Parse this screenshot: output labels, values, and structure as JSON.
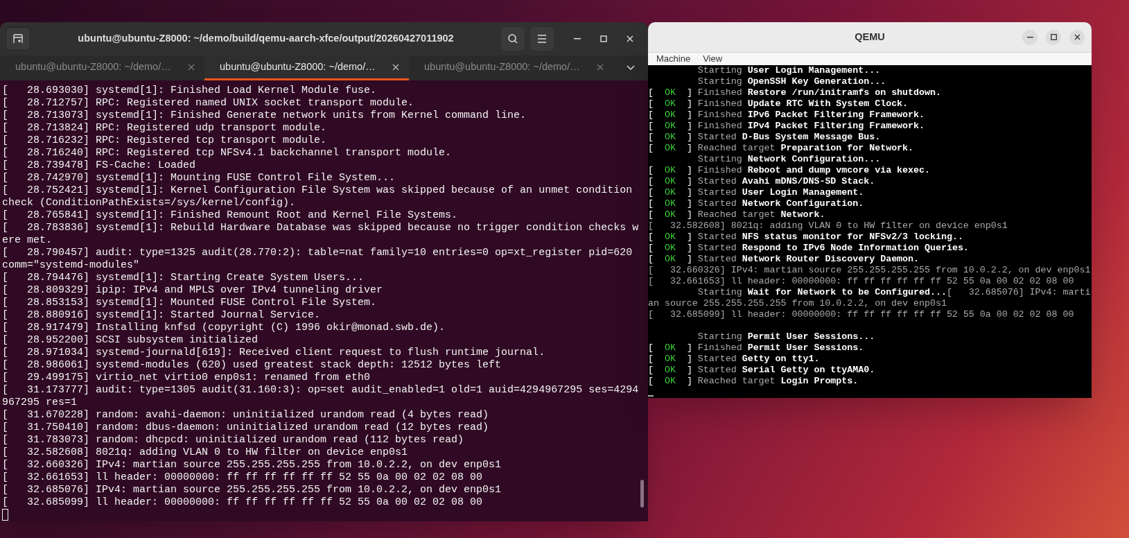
{
  "terminal": {
    "title": "ubuntu@ubuntu-Z8000: ~/demo/build/qemu-aarch-xfce/output/20260427011902",
    "tabs": [
      {
        "label": "ubuntu@ubuntu-Z8000: ~/demo/…",
        "selected": false
      },
      {
        "label": "ubuntu@ubuntu-Z8000: ~/demo/…",
        "selected": true
      },
      {
        "label": "ubuntu@ubuntu-Z8000: ~/demo/…",
        "selected": false
      }
    ],
    "lines": [
      "[   28.693030] systemd[1]: Finished Load Kernel Module fuse.",
      "[   28.712757] RPC: Registered named UNIX socket transport module.",
      "[   28.713073] systemd[1]: Finished Generate network units from Kernel command line.",
      "[   28.713824] RPC: Registered udp transport module.",
      "[   28.716232] RPC: Registered tcp transport module.",
      "[   28.716240] RPC: Registered tcp NFSv4.1 backchannel transport module.",
      "[   28.739478] FS-Cache: Loaded",
      "[   28.742970] systemd[1]: Mounting FUSE Control File System...",
      "[   28.752421] systemd[1]: Kernel Configuration File System was skipped because of an unmet condition",
      "check (ConditionPathExists=/sys/kernel/config).",
      "[   28.765841] systemd[1]: Finished Remount Root and Kernel File Systems.",
      "[   28.783836] systemd[1]: Rebuild Hardware Database was skipped because no trigger condition checks w",
      "ere met.",
      "[   28.790457] audit: type=1325 audit(28.770:2): table=nat family=10 entries=0 op=xt_register pid=620",
      "comm=\"systemd-modules\"",
      "[   28.794476] systemd[1]: Starting Create System Users...",
      "[   28.809329] ipip: IPv4 and MPLS over IPv4 tunneling driver",
      "[   28.853153] systemd[1]: Mounted FUSE Control File System.",
      "[   28.880916] systemd[1]: Started Journal Service.",
      "[   28.917479] Installing knfsd (copyright (C) 1996 okir@monad.swb.de).",
      "[   28.952200] SCSI subsystem initialized",
      "[   28.971034] systemd-journald[619]: Received client request to flush runtime journal.",
      "[   28.986061] systemd-modules (620) used greatest stack depth: 12512 bytes left",
      "[   29.499175] virtio_net virtio0 enp0s1: renamed from eth0",
      "[   31.173777] audit: type=1305 audit(31.160:3): op=set audit_enabled=1 old=1 auid=4294967295 ses=4294",
      "967295 res=1",
      "[   31.670228] random: avahi-daemon: uninitialized urandom read (4 bytes read)",
      "[   31.750410] random: dbus-daemon: uninitialized urandom read (12 bytes read)",
      "[   31.783073] random: dhcpcd: uninitialized urandom read (112 bytes read)",
      "[   32.582608] 8021q: adding VLAN 0 to HW filter on device enp0s1",
      "[   32.660326] IPv4: martian source 255.255.255.255 from 10.0.2.2, on dev enp0s1",
      "[   32.661653] ll header: 00000000: ff ff ff ff ff ff 52 55 0a 00 02 02 08 00",
      "[   32.685076] IPv4: martian source 255.255.255.255 from 10.0.2.2, on dev enp0s1",
      "[   32.685099] ll header: 00000000: ff ff ff ff ff ff 52 55 0a 00 02 02 08 00"
    ]
  },
  "qemu": {
    "title": "QEMU",
    "menu": [
      "Machine",
      "View"
    ],
    "lines": [
      {
        "kind": "unit",
        "verb": "Starting",
        "target": "User Login Management..."
      },
      {
        "kind": "unit",
        "verb": "Starting",
        "target": "OpenSSH Key Generation..."
      },
      {
        "kind": "unit",
        "status": "[  OK  ]",
        "verb": "Finished",
        "target": "Restore /run/initramfs on shutdown."
      },
      {
        "kind": "unit",
        "status": "[  OK  ]",
        "verb": "Finished",
        "target": "Update RTC With System Clock."
      },
      {
        "kind": "unit",
        "status": "[  OK  ]",
        "verb": "Finished",
        "target": "IPv6 Packet Filtering Framework."
      },
      {
        "kind": "unit",
        "status": "[  OK  ]",
        "verb": "Finished",
        "target": "IPv4 Packet Filtering Framework."
      },
      {
        "kind": "unit",
        "status": "[  OK  ]",
        "verb": "Started",
        "target": "D-Bus System Message Bus."
      },
      {
        "kind": "unit",
        "status": "[  OK  ]",
        "verb": "Reached target",
        "target": "Preparation for Network."
      },
      {
        "kind": "unit",
        "verb": "Starting",
        "target": "Network Configuration..."
      },
      {
        "kind": "unit",
        "status": "[  OK  ]",
        "verb": "Finished",
        "target": "Reboot and dump vmcore via kexec."
      },
      {
        "kind": "unit",
        "status": "[  OK  ]",
        "verb": "Started",
        "target": "Avahi mDNS/DNS-SD Stack."
      },
      {
        "kind": "unit",
        "status": "[  OK  ]",
        "verb": "Started",
        "target": "User Login Management."
      },
      {
        "kind": "unit",
        "status": "[  OK  ]",
        "verb": "Started",
        "target": "Network Configuration."
      },
      {
        "kind": "unit",
        "status": "[  OK  ]",
        "verb": "Reached target",
        "target": "Network."
      },
      {
        "kind": "kernel",
        "text": "[   32.582608] 8021q: adding VLAN 0 to HW filter on device enp0s1"
      },
      {
        "kind": "unit",
        "status": "[  OK  ]",
        "verb": "Started",
        "target": "NFS status monitor for NFSv2/3 locking.."
      },
      {
        "kind": "unit",
        "status": "[  OK  ]",
        "verb": "Started",
        "target": "Respond to IPv6 Node Information Queries."
      },
      {
        "kind": "unit",
        "status": "[  OK  ]",
        "verb": "Started",
        "target": "Network Router Discovery Daemon."
      },
      {
        "kind": "kernel",
        "text": "[   32.660326] IPv4: martian source 255.255.255.255 from 10.0.2.2, on dev enp0s1"
      },
      {
        "kind": "kernel",
        "text": "[   32.661653] ll header: 00000000: ff ff ff ff ff ff 52 55 0a 00 02 02 08 00"
      },
      {
        "kind": "unit",
        "verb": "Starting",
        "target": "Wait for Network to be Configured...",
        "rest": "[   32.685076] IPv4: marti"
      },
      {
        "kind": "kernel",
        "text": "an source 255.255.255.255 from 10.0.2.2, on dev enp0s1"
      },
      {
        "kind": "kernel",
        "text": "[   32.685099] ll header: 00000000: ff ff ff ff ff ff 52 55 0a 00 02 02 08 00"
      },
      {
        "kind": "blank"
      },
      {
        "kind": "unit",
        "verb": "Starting",
        "target": "Permit User Sessions..."
      },
      {
        "kind": "unit",
        "status": "[  OK  ]",
        "verb": "Finished",
        "target": "Permit User Sessions."
      },
      {
        "kind": "unit",
        "status": "[  OK  ]",
        "verb": "Started",
        "target": "Getty on tty1."
      },
      {
        "kind": "unit",
        "status": "[  OK  ]",
        "verb": "Started",
        "target": "Serial Getty on ttyAMA0."
      },
      {
        "kind": "unit",
        "status": "[  OK  ]",
        "verb": "Reached target",
        "target": "Login Prompts."
      }
    ]
  }
}
